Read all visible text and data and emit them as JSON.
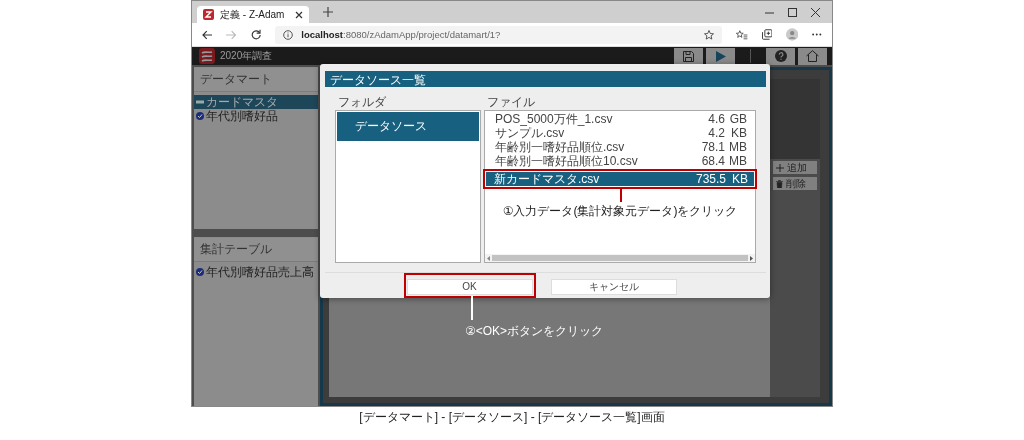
{
  "browser": {
    "tab_title": "定義 - Z-Adam",
    "url_host": "localhost",
    "url_path": ":8080/zAdamApp/project/datamart/1?"
  },
  "app": {
    "title": "2020年調査"
  },
  "sidebar": {
    "datamart": {
      "heading": "データマート",
      "items": [
        {
          "label": "カードマスタ",
          "selected": true
        },
        {
          "label": "年代別嗜好品",
          "selected": false
        }
      ]
    },
    "aggregate": {
      "heading": "集計テーブル",
      "items": [
        {
          "label": "年代別嗜好品売上高",
          "selected": false
        }
      ]
    }
  },
  "side_actions": [
    {
      "label": "追加",
      "kind": "add"
    },
    {
      "label": "削除",
      "kind": "delete"
    }
  ],
  "dialog": {
    "title": "データソース一覧",
    "folder_heading": "フォルダ",
    "folders": [
      {
        "label": "データソース",
        "selected": true
      }
    ],
    "file_heading": "ファイル",
    "files": [
      {
        "name": "POS_5000万件_1.csv",
        "size": "4.6",
        "unit": "GB",
        "selected": false,
        "highlighted": false
      },
      {
        "name": "サンプル.csv",
        "size": "4.2",
        "unit": "KB",
        "selected": false,
        "highlighted": false
      },
      {
        "name": "年齢別一嗜好品順位.csv",
        "size": "78.1",
        "unit": "MB",
        "selected": false,
        "highlighted": false
      },
      {
        "name": "年齢別一嗜好品順位10.csv",
        "size": "68.4",
        "unit": "MB",
        "selected": false,
        "highlighted": false
      },
      {
        "name": "新カードマスタ.csv",
        "size": "735.5",
        "unit": "KB",
        "selected": true,
        "highlighted": true
      }
    ],
    "buttons": [
      {
        "label": "OK",
        "highlighted": true
      },
      {
        "label": "キャンセル",
        "highlighted": false
      }
    ]
  },
  "annotations": [
    {
      "kind": "file",
      "text": "①入力データ(集計対象元データ)をクリック"
    },
    {
      "kind": "button",
      "text": "②<OK>ボタンをクリック"
    }
  ],
  "caption": "[データマート] - [データソース] - [データソース一覧]画面"
}
